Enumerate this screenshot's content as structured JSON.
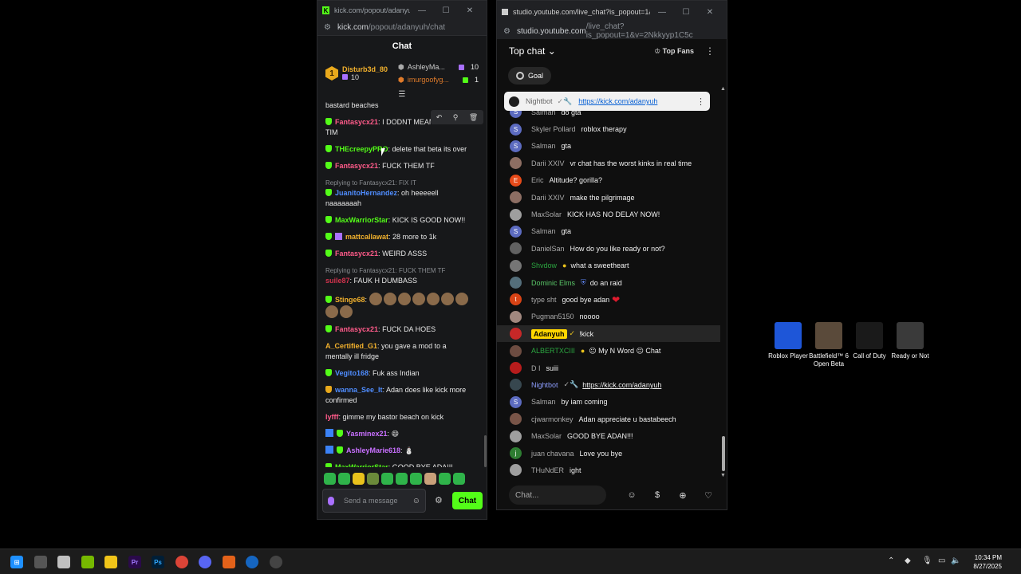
{
  "kick": {
    "window_title": "kick.com/popout/adanyuh/...",
    "url_host": "kick.com",
    "url_path": "/popout/adanyuh/chat",
    "header": "Chat",
    "leaderboard": {
      "first": {
        "rank": "1",
        "name": "Disturb3d_80",
        "count": "10"
      },
      "second": {
        "name": "AshleyMa...",
        "count": "10"
      },
      "third": {
        "name": "imurgoofyg...",
        "count": "1"
      }
    },
    "partial_top": "bastard beaches",
    "messages": [
      {
        "user": "Fantasycx21",
        "color": "#ff5b8a",
        "badge": "mod",
        "text": "I DODNT MEAN TO SAY TIM"
      },
      {
        "user": "THEcreepyPRO",
        "color": "#53fc18",
        "badge": "mod",
        "text": "delete that beta its over"
      },
      {
        "user": "Fantasycx21",
        "color": "#ff5b8a",
        "badge": "mod",
        "text": "FUCK THEM TF"
      },
      {
        "reply": "Replying to Fantasycx21: FIX IT",
        "user": "JuanitoHernandez",
        "color": "#4f8dff",
        "badge": "mod",
        "text": "oh heeeeell naaaaaaah"
      },
      {
        "user": "MaxWarriorStar",
        "color": "#53fc18",
        "badge": "mod",
        "text": "KICK IS GOOD NOW!!"
      },
      {
        "user": "mattcallawat",
        "color": "#f2b12d",
        "badge": "mod-gift",
        "text": "28 more to 1k"
      },
      {
        "user": "Fantasycx21",
        "color": "#ff5b8a",
        "badge": "mod",
        "text": "WEIRD ASSS"
      },
      {
        "reply": "Replying to Fantasycx21: FUCK THEM TF",
        "user": "suile87",
        "color": "#d1334d",
        "badge": "none",
        "text": "FAUK H DUMBASS"
      },
      {
        "user": "Stinge68",
        "color": "#f2b12d",
        "badge": "mod",
        "text": "",
        "emotes": 9
      },
      {
        "user": "Fantasycx21",
        "color": "#ff5b8a",
        "badge": "mod",
        "text": "FUCK DA HOES"
      },
      {
        "user": "A_Certified_G1",
        "color": "#f2b12d",
        "badge": "none",
        "text": "you gave a mod to a mentally ill fridge"
      },
      {
        "user": "Vegito168",
        "color": "#4f8dff",
        "badge": "mod",
        "text": "Fuk ass Indian"
      },
      {
        "user": "wanna_See_It",
        "color": "#4f8dff",
        "badge": "gold",
        "text": "Adan does like kick more confirmed"
      },
      {
        "user": "lyfff",
        "color": "#ff5b8a",
        "badge": "none",
        "text": "gimme my bastor beach on kick"
      },
      {
        "user": "Yasminex21",
        "color": "#c870ff",
        "badge": "blue-mod",
        "text": "😄"
      },
      {
        "user": "AshleyMarie618",
        "color": "#c870ff",
        "badge": "blue-mod",
        "text": "⛄"
      },
      {
        "user": "MaxWarriorStar",
        "color": "#53fc18",
        "badge": "mod",
        "text": "GOOD BYE ADA!!!"
      }
    ],
    "input_placeholder": "Send a message",
    "chat_button": "Chat"
  },
  "youtube": {
    "window_title": "studio.youtube.com/live_chat?is_popout=1&v=2...",
    "url_host": "studio.youtube.com",
    "url_path": "/live_chat?is_popout=1&v=2Nkkyyp1C5c",
    "top_chat": "Top chat",
    "top_fans": "Top Fans",
    "goal": "Goal",
    "pinned": {
      "name": "Nightbot",
      "link": "https://kick.com/adanyuh"
    },
    "messages": [
      {
        "name": "Salman",
        "text": "do gta",
        "av": "S",
        "avc": "#5c6bc0",
        "role": "none"
      },
      {
        "name": "Skyler Pollard",
        "text": "roblox therapy",
        "av": "S",
        "avc": "#5c6bc0",
        "role": "none"
      },
      {
        "name": "Salman",
        "text": "gta",
        "av": "S",
        "avc": "#5c6bc0",
        "role": "none"
      },
      {
        "name": "Darii XXIV",
        "text": "vr chat has the worst kinks in real time",
        "av": "",
        "avc": "#8d6e63",
        "role": "none"
      },
      {
        "name": "Eric",
        "text": "Altitude? gorilla?",
        "av": "E",
        "avc": "#e64a19",
        "role": "none"
      },
      {
        "name": "Darii XXIV",
        "text": "make the pilgrimage",
        "av": "",
        "avc": "#8d6e63",
        "role": "none"
      },
      {
        "name": "MaxSolar",
        "text": "KICK HAS NO DELAY NOW!",
        "av": "",
        "avc": "#9e9e9e",
        "role": "none"
      },
      {
        "name": "Salman",
        "text": "gta",
        "av": "S",
        "avc": "#5c6bc0",
        "role": "none"
      },
      {
        "name": "DanielSan",
        "text": "How do you like ready or not?",
        "av": "",
        "avc": "#616161",
        "role": "none"
      },
      {
        "name": "Shvdow",
        "text": "what a sweetheart",
        "av": "",
        "avc": "#757575",
        "role": "mem"
      },
      {
        "name": "Dominic Elms",
        "text": "do an raid",
        "av": "",
        "avc": "#546e7a",
        "role": "mod"
      },
      {
        "name": "type sht",
        "text": "good bye adan",
        "av": "t",
        "avc": "#d84315",
        "role": "none",
        "heart": "❤"
      },
      {
        "name": "Pugman5150",
        "text": "noooo",
        "av": "",
        "avc": "#a1887f",
        "role": "none"
      },
      {
        "name": "Adanyuh",
        "text": "!kick",
        "av": "",
        "avc": "#c62828",
        "role": "owner"
      },
      {
        "name": "ALBERTXCIII",
        "text": "😐 My N Word 😐 Chat",
        "av": "",
        "avc": "#6d4c41",
        "role": "mem"
      },
      {
        "name": "D I",
        "text": "suiii",
        "av": "",
        "avc": "#b71c1c",
        "role": "none"
      },
      {
        "name": "Nightbot",
        "text": "https://kick.com/adanyuh",
        "av": "",
        "avc": "#37474f",
        "role": "bot"
      },
      {
        "name": "Salman",
        "text": "by iam coming",
        "av": "S",
        "avc": "#5c6bc0",
        "role": "none"
      },
      {
        "name": "cjwarmonkey",
        "text": "Adan appreciate u bastabeech",
        "av": "",
        "avc": "#795548",
        "role": "none"
      },
      {
        "name": "MaxSolar",
        "text": "GOOD BYE ADAN!!!",
        "av": "",
        "avc": "#9e9e9e",
        "role": "none"
      },
      {
        "name": "juan chavana",
        "text": "Love you bye",
        "av": "j",
        "avc": "#2e7d32",
        "role": "none"
      },
      {
        "name": "THuNdER",
        "text": "ight",
        "av": "",
        "avc": "#9e9e9e",
        "role": "none"
      }
    ],
    "input_placeholder": "Chat..."
  },
  "desktop_icons": [
    {
      "label": "Roblox Player",
      "color": "#1e56d8"
    },
    {
      "label": "Battlefield™ 6 Open Beta",
      "color": "#5a4a3a"
    },
    {
      "label": "Call of Duty",
      "color": "#1a1a1a"
    },
    {
      "label": "Ready or Not",
      "color": "#3a3a3a"
    }
  ],
  "taskbar": {
    "time": "10:34 PM",
    "date": "8/27/2025"
  }
}
